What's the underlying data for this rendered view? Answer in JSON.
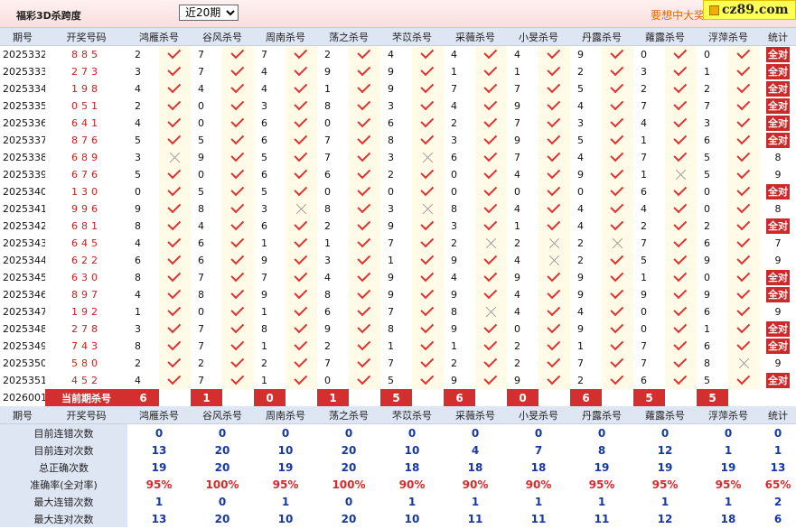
{
  "header": {
    "title": "福彩3D杀跨度",
    "period_select": "近20期",
    "slogan": "要想中大奖",
    "logo_text": "cz89.com"
  },
  "columns": {
    "issue": "期号",
    "draw": "开奖号码",
    "experts": [
      "鸿雁杀号",
      "谷风杀号",
      "周南杀号",
      "荡之杀号",
      "芣苡杀号",
      "采薇杀号",
      "小旻杀号",
      "丹露杀号",
      "蕹露杀号",
      "浮萍杀号"
    ],
    "stat": "统计"
  },
  "colors": {
    "accent_red": "#d32f2f",
    "check_red": "#e23030",
    "header_blue": "#dfe6f3",
    "value_blue": "#1438a8"
  },
  "rows": [
    {
      "issue": "2025332",
      "draw": "885",
      "kills": [
        2,
        7,
        7,
        2,
        4,
        4,
        4,
        9,
        0,
        0
      ],
      "hits": [
        1,
        1,
        1,
        1,
        1,
        1,
        1,
        1,
        1,
        1
      ],
      "stat": "全对"
    },
    {
      "issue": "2025333",
      "draw": "273",
      "kills": [
        3,
        7,
        4,
        9,
        9,
        1,
        1,
        2,
        3,
        1
      ],
      "hits": [
        1,
        1,
        1,
        1,
        1,
        1,
        1,
        1,
        1,
        1
      ],
      "stat": "全对"
    },
    {
      "issue": "2025334",
      "draw": "198",
      "kills": [
        4,
        4,
        4,
        1,
        9,
        7,
        7,
        5,
        2,
        2
      ],
      "hits": [
        1,
        1,
        1,
        1,
        1,
        1,
        1,
        1,
        1,
        1
      ],
      "stat": "全对"
    },
    {
      "issue": "2025335",
      "draw": "051",
      "kills": [
        2,
        0,
        3,
        8,
        3,
        4,
        9,
        4,
        7,
        7
      ],
      "hits": [
        1,
        1,
        1,
        1,
        1,
        1,
        1,
        1,
        1,
        1
      ],
      "stat": "全对"
    },
    {
      "issue": "2025336",
      "draw": "641",
      "kills": [
        4,
        0,
        6,
        0,
        6,
        2,
        7,
        3,
        4,
        3
      ],
      "hits": [
        1,
        1,
        1,
        1,
        1,
        1,
        1,
        1,
        1,
        1
      ],
      "stat": "全对"
    },
    {
      "issue": "2025337",
      "draw": "876",
      "kills": [
        5,
        5,
        6,
        7,
        8,
        3,
        9,
        5,
        1,
        6
      ],
      "hits": [
        1,
        1,
        1,
        1,
        1,
        1,
        1,
        1,
        1,
        1
      ],
      "stat": "全对"
    },
    {
      "issue": "2025338",
      "draw": "689",
      "kills": [
        3,
        9,
        5,
        7,
        3,
        6,
        7,
        4,
        7,
        5
      ],
      "hits": [
        0,
        1,
        1,
        1,
        0,
        1,
        1,
        1,
        1,
        1
      ],
      "stat": "8"
    },
    {
      "issue": "2025339",
      "draw": "676",
      "kills": [
        5,
        0,
        6,
        6,
        2,
        0,
        4,
        9,
        1,
        5
      ],
      "hits": [
        1,
        1,
        1,
        1,
        1,
        1,
        1,
        1,
        0,
        1
      ],
      "stat": "9"
    },
    {
      "issue": "2025340",
      "draw": "130",
      "kills": [
        0,
        5,
        5,
        0,
        0,
        0,
        0,
        0,
        6,
        0
      ],
      "hits": [
        1,
        1,
        1,
        1,
        1,
        1,
        1,
        1,
        1,
        1
      ],
      "stat": "全对"
    },
    {
      "issue": "2025341",
      "draw": "996",
      "kills": [
        9,
        8,
        3,
        8,
        3,
        8,
        4,
        4,
        4,
        0
      ],
      "hits": [
        1,
        1,
        0,
        1,
        0,
        1,
        1,
        1,
        1,
        1
      ],
      "stat": "8"
    },
    {
      "issue": "2025342",
      "draw": "681",
      "kills": [
        8,
        4,
        6,
        2,
        9,
        3,
        1,
        4,
        2,
        2
      ],
      "hits": [
        1,
        1,
        1,
        1,
        1,
        1,
        1,
        1,
        1,
        1
      ],
      "stat": "全对"
    },
    {
      "issue": "2025343",
      "draw": "645",
      "kills": [
        4,
        6,
        1,
        1,
        7,
        2,
        2,
        2,
        7,
        6
      ],
      "hits": [
        1,
        1,
        1,
        1,
        1,
        0,
        0,
        0,
        1,
        1
      ],
      "stat": "7"
    },
    {
      "issue": "2025344",
      "draw": "622",
      "kills": [
        6,
        6,
        9,
        3,
        1,
        9,
        4,
        2,
        5,
        9
      ],
      "hits": [
        1,
        1,
        1,
        1,
        1,
        1,
        0,
        1,
        1,
        1
      ],
      "stat": "9"
    },
    {
      "issue": "2025345",
      "draw": "630",
      "kills": [
        8,
        7,
        7,
        4,
        9,
        4,
        9,
        9,
        1,
        0
      ],
      "hits": [
        1,
        1,
        1,
        1,
        1,
        1,
        1,
        1,
        1,
        1
      ],
      "stat": "全对"
    },
    {
      "issue": "2025346",
      "draw": "897",
      "kills": [
        4,
        8,
        9,
        8,
        9,
        9,
        4,
        9,
        9,
        9
      ],
      "hits": [
        1,
        1,
        1,
        1,
        1,
        1,
        1,
        1,
        1,
        1
      ],
      "stat": "全对"
    },
    {
      "issue": "2025347",
      "draw": "192",
      "kills": [
        1,
        0,
        1,
        6,
        7,
        8,
        4,
        4,
        0,
        6
      ],
      "hits": [
        1,
        1,
        1,
        1,
        1,
        0,
        1,
        1,
        1,
        1
      ],
      "stat": "9"
    },
    {
      "issue": "2025348",
      "draw": "278",
      "kills": [
        3,
        7,
        8,
        9,
        8,
        9,
        0,
        9,
        0,
        1
      ],
      "hits": [
        1,
        1,
        1,
        1,
        1,
        1,
        1,
        1,
        1,
        1
      ],
      "stat": "全对"
    },
    {
      "issue": "2025349",
      "draw": "743",
      "kills": [
        8,
        7,
        1,
        2,
        1,
        1,
        2,
        1,
        7,
        6
      ],
      "hits": [
        1,
        1,
        1,
        1,
        1,
        1,
        1,
        1,
        1,
        1
      ],
      "stat": "全对"
    },
    {
      "issue": "2025350",
      "draw": "580",
      "kills": [
        2,
        2,
        2,
        7,
        7,
        2,
        2,
        7,
        7,
        8
      ],
      "hits": [
        1,
        1,
        1,
        1,
        1,
        1,
        1,
        1,
        1,
        0
      ],
      "stat": "9"
    },
    {
      "issue": "2025351",
      "draw": "452",
      "kills": [
        4,
        7,
        1,
        0,
        5,
        9,
        9,
        2,
        6,
        5
      ],
      "hits": [
        1,
        1,
        1,
        1,
        1,
        1,
        1,
        1,
        1,
        1
      ],
      "stat": "全对"
    }
  ],
  "current": {
    "issue": "2026001",
    "label": "当前期杀号",
    "kills": [
      6,
      1,
      0,
      1,
      5,
      6,
      0,
      6,
      5,
      5
    ]
  },
  "summary": [
    {
      "label": "目前连错次数",
      "values": [
        "0",
        "0",
        "0",
        "0",
        "0",
        "0",
        "0",
        "0",
        "0",
        "0",
        "0"
      ],
      "red": false
    },
    {
      "label": "目前连对次数",
      "values": [
        "13",
        "20",
        "10",
        "20",
        "10",
        "4",
        "7",
        "8",
        "12",
        "1",
        "1"
      ],
      "red": false
    },
    {
      "label": "总正确次数",
      "values": [
        "19",
        "20",
        "19",
        "20",
        "18",
        "18",
        "18",
        "19",
        "19",
        "19",
        "13"
      ],
      "red": false
    },
    {
      "label": "准确率(全对率)",
      "values": [
        "95%",
        "100%",
        "95%",
        "100%",
        "90%",
        "90%",
        "90%",
        "95%",
        "95%",
        "95%",
        "65%"
      ],
      "red": true
    },
    {
      "label": "最大连错次数",
      "values": [
        "1",
        "0",
        "1",
        "0",
        "1",
        "1",
        "1",
        "1",
        "1",
        "1",
        "2"
      ],
      "red": false
    },
    {
      "label": "最大连对次数",
      "values": [
        "13",
        "20",
        "10",
        "20",
        "10",
        "11",
        "11",
        "11",
        "12",
        "18",
        "6"
      ],
      "red": false
    }
  ]
}
